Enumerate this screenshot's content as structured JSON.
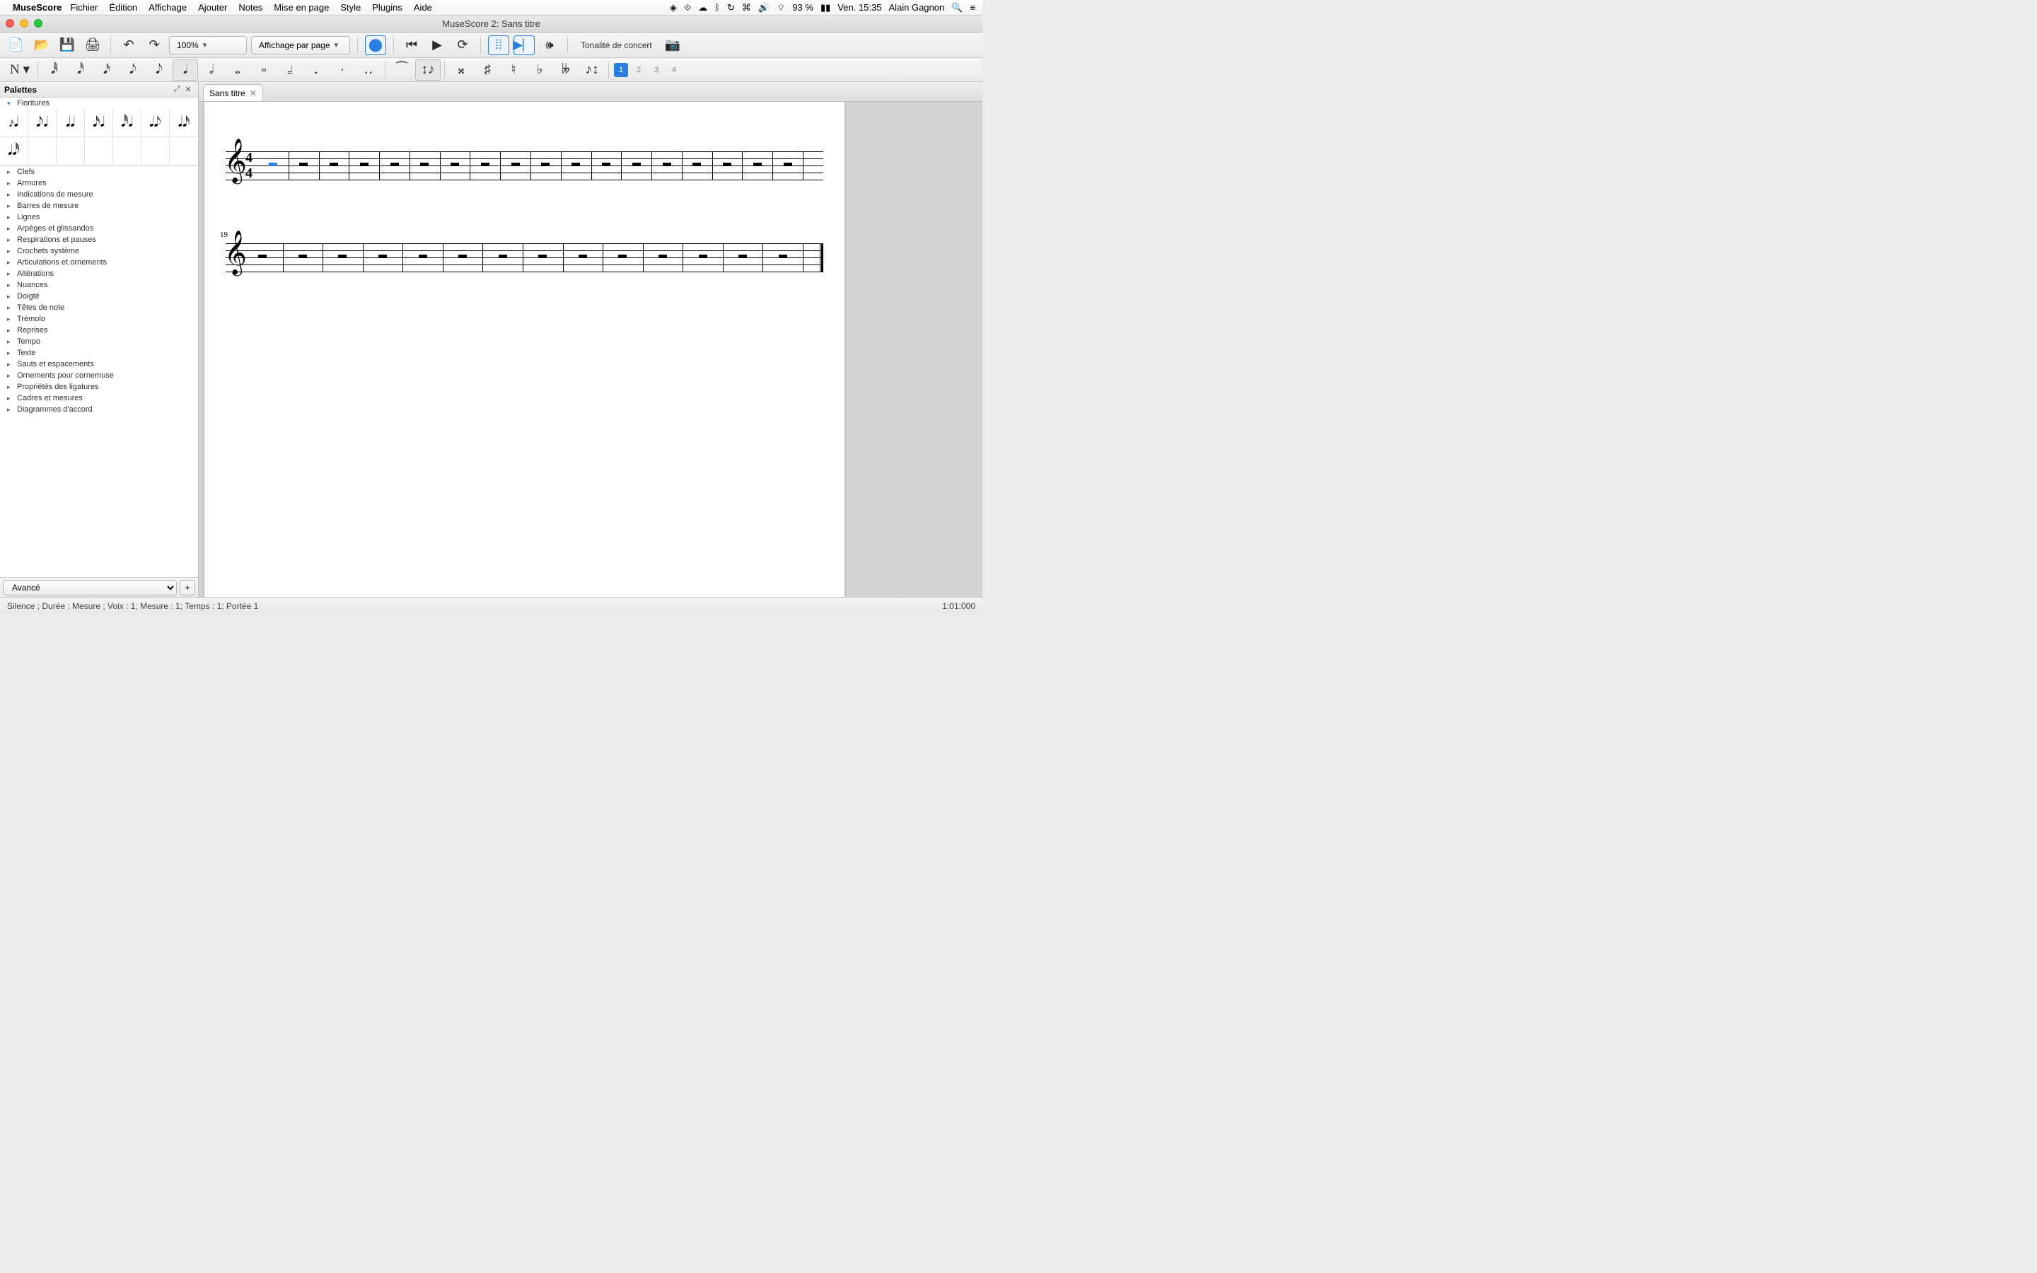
{
  "menubar": {
    "app_name": "MuseScore",
    "items": [
      "Fichier",
      "Édition",
      "Affichage",
      "Ajouter",
      "Notes",
      "Mise en page",
      "Style",
      "Plugins",
      "Aide"
    ],
    "status": {
      "battery_pct": "93 %",
      "day_time": "Ven. 15:35",
      "user": "Alain Gagnon"
    }
  },
  "window": {
    "title": "MuseScore 2: Sans titre"
  },
  "toolbar": {
    "zoom": "100%",
    "view_mode": "Affichage par page",
    "concert_pitch_label": "Tonalité de concert"
  },
  "voices": {
    "current": "1",
    "others": [
      "2",
      "3",
      "4"
    ]
  },
  "palettes": {
    "title": "Palettes",
    "open_section": "Fioritures",
    "sections": [
      "Clefs",
      "Armures",
      "Indications de mesure",
      "Barres de mesure",
      "Lignes",
      "Arpèges et glissandos",
      "Respirations et pauses",
      "Crochets système",
      "Articulations et ornements",
      "Altérations",
      "Nuances",
      "Doigté",
      "Têtes de note",
      "Trémolo",
      "Reprises",
      "Tempo",
      "Texte",
      "Sauts et espacements",
      "Ornements pour cornemuse",
      "Propriétés des ligatures",
      "Cadres et mesures",
      "Diagrammes d'accord"
    ],
    "workspace_select": "Avancé"
  },
  "document": {
    "tab_title": "Sans titre",
    "system2_start_measure": "19"
  },
  "status": {
    "left": "Silence ; Durée : Mesure ; Voix : 1;  Mesure : 1; Temps : 1; Portée 1",
    "right": "1:01:000"
  }
}
